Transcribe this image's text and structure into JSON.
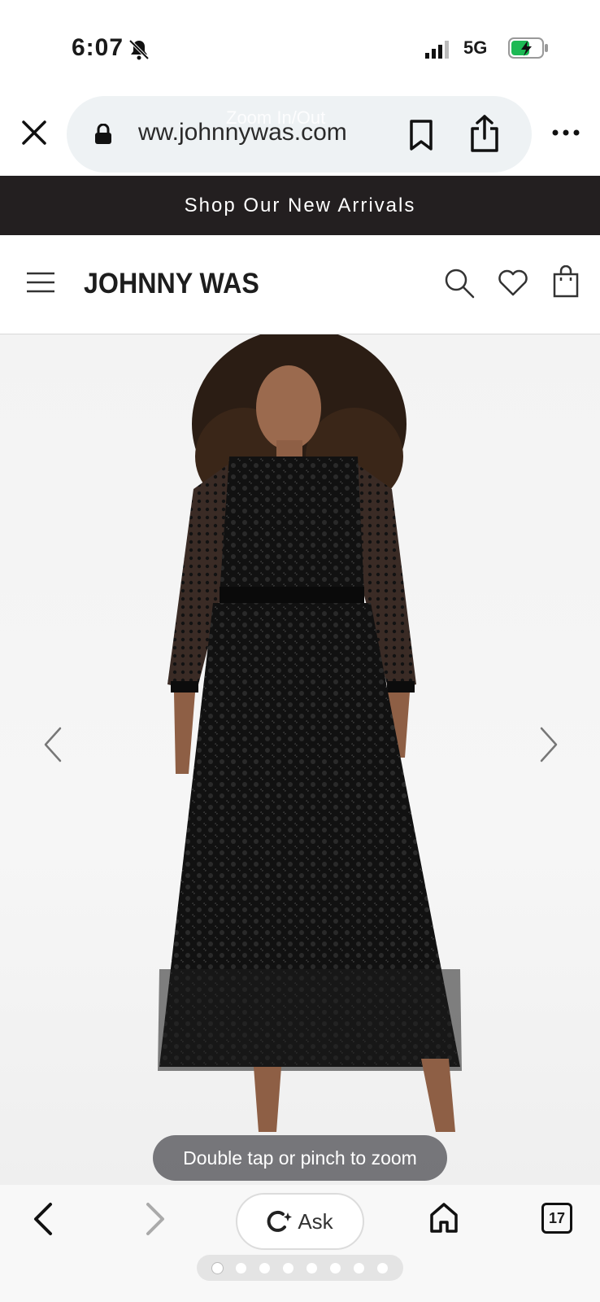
{
  "status_bar": {
    "time": "6:07",
    "network": "5G",
    "icons": [
      "mute-bell-icon",
      "signal-icon",
      "battery-charging-icon"
    ]
  },
  "browser": {
    "url": "ww.johnnywas.com",
    "overlay_hint": "Zoom In/Out",
    "icons": [
      "close-icon",
      "lock-icon",
      "bookmark-icon",
      "share-icon",
      "more-icon"
    ]
  },
  "promo_banner": {
    "text": "Shop Our New Arrivals"
  },
  "site_header": {
    "brand": "JOHNNY WAS",
    "icons": [
      "menu-icon",
      "search-icon",
      "heart-icon",
      "shopping-bag-icon"
    ]
  },
  "product_gallery": {
    "image_alt": "Model wearing a long black lace maxi dress",
    "toast": "Double tap or pinch to zoom",
    "slide_count": 8,
    "active_slide": 1,
    "icons": [
      "chevron-left-icon",
      "chevron-right-icon"
    ]
  },
  "bottom_toolbar": {
    "ask_label": "Ask",
    "tab_count": "17",
    "icons": [
      "back-icon",
      "forward-icon",
      "ask-ai-icon",
      "home-icon",
      "tabs-icon"
    ]
  },
  "colors": {
    "banner_bg": "#231f20",
    "url_pill_bg": "#eef2f4",
    "toast_bg": "#5a5a5f"
  }
}
